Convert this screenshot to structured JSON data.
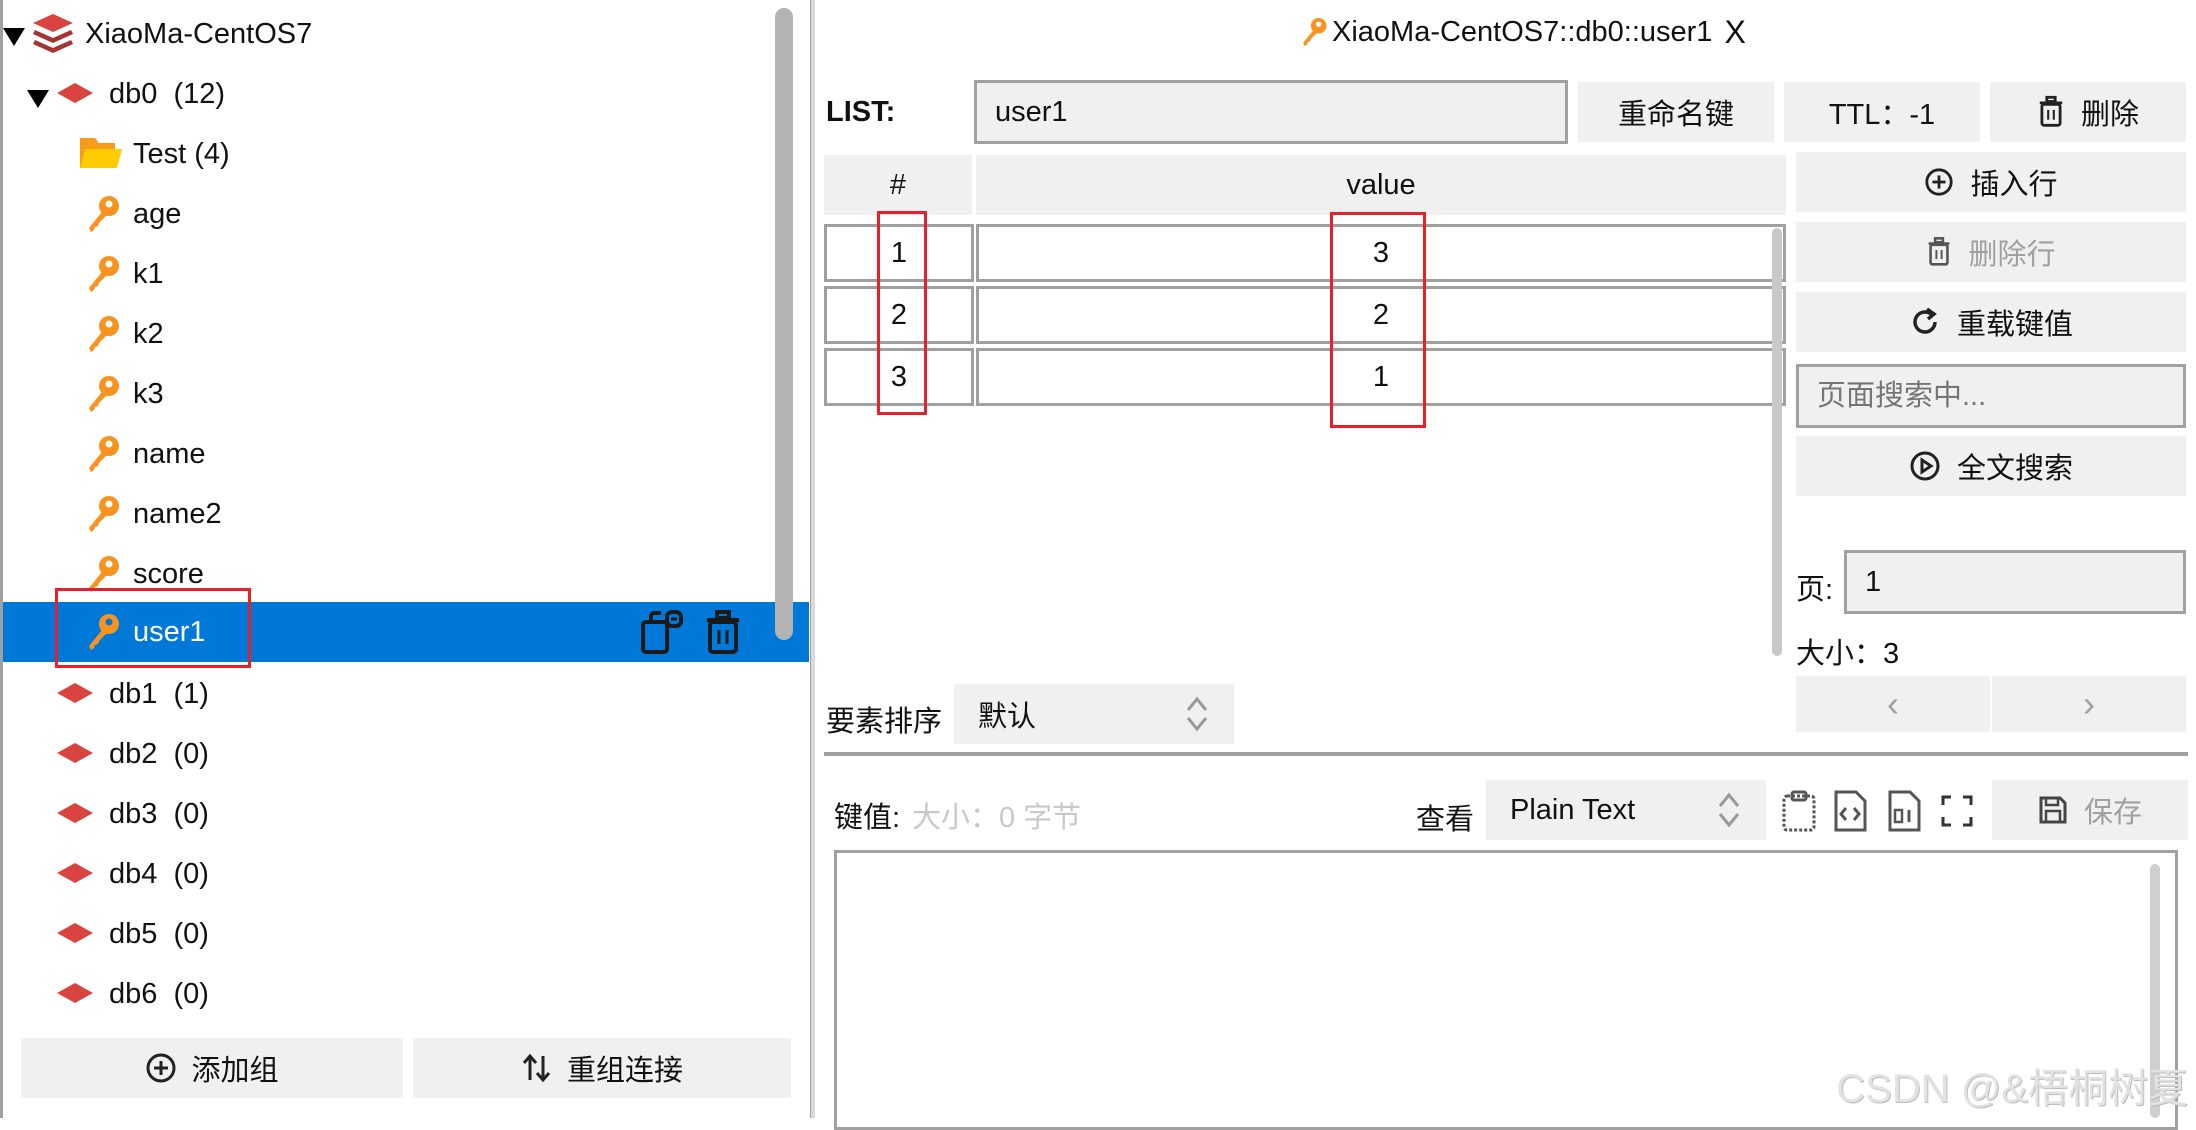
{
  "tree": {
    "connection": {
      "label": "XiaoMa-CentOS7",
      "expanded": true
    },
    "databases": [
      {
        "label": "db0  (12)",
        "expanded": true
      },
      {
        "label": "db1  (1)"
      },
      {
        "label": "db2  (0)"
      },
      {
        "label": "db3  (0)"
      },
      {
        "label": "db4  (0)"
      },
      {
        "label": "db5  (0)"
      },
      {
        "label": "db6  (0)"
      }
    ],
    "folder": {
      "label": "Test (4)"
    },
    "keys": [
      "age",
      "k1",
      "k2",
      "k3",
      "name",
      "name2",
      "score",
      "user1"
    ],
    "selected_key": "user1",
    "buttons": {
      "add_group": "添加组",
      "regroup": "重组连接"
    }
  },
  "tab": {
    "title": "XiaoMa-CentOS7::db0::user1",
    "close": "X"
  },
  "key_header": {
    "type_label": "LIST:",
    "key_name": "user1",
    "rename_label": "重命名键",
    "ttl_label": "TTL：-1",
    "delete_label": "删除"
  },
  "table": {
    "columns": [
      "#",
      "value"
    ],
    "rows": [
      {
        "index": "1",
        "value": "3"
      },
      {
        "index": "2",
        "value": "2"
      },
      {
        "index": "3",
        "value": "1"
      }
    ]
  },
  "side_actions": {
    "insert_row": "插入行",
    "delete_row": "删除行",
    "reload": "重载键值",
    "search_placeholder": "页面搜索中...",
    "fulltext_search": "全文搜索",
    "page_label": "页:",
    "page_value": "1",
    "size_label": "大小：3",
    "prev": "‹",
    "next": "›"
  },
  "sort": {
    "label": "要素排序",
    "value": "默认"
  },
  "value_editor": {
    "label": "键值:",
    "size_hint": "大小：0 字节",
    "view_label": "查看",
    "view_value": "Plain Text",
    "save_label": "保存",
    "content": ""
  },
  "watermark": "CSDN @&梧桐树夏"
}
